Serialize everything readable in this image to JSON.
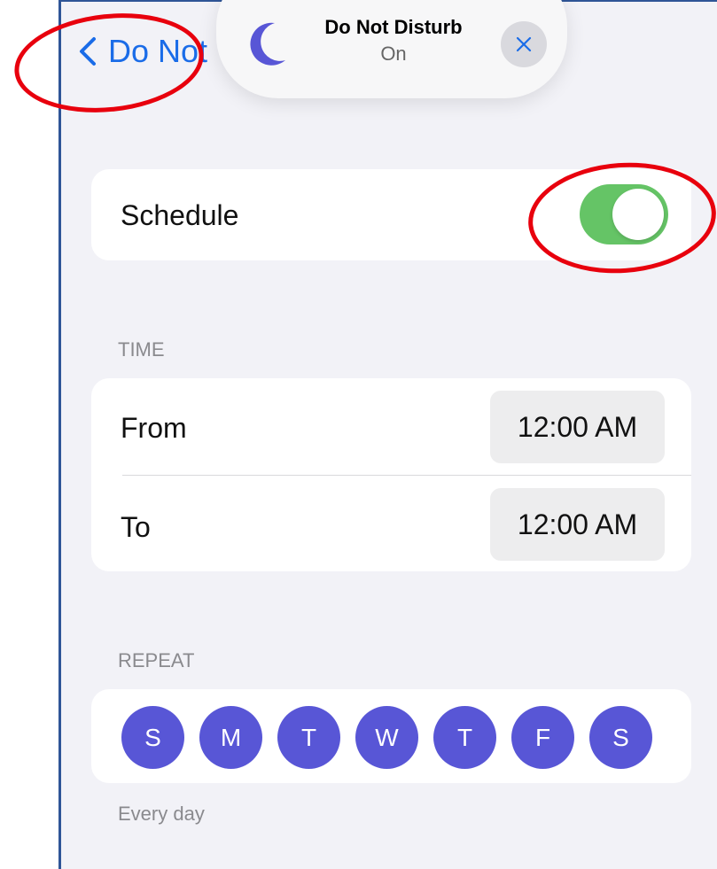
{
  "nav": {
    "back_label": "Do Not",
    "back_icon": "chevron-left-icon"
  },
  "banner": {
    "title": "Do Not Disturb",
    "status": "On",
    "icon": "moon-icon",
    "close_icon": "close-icon"
  },
  "schedule": {
    "label": "Schedule",
    "enabled": true
  },
  "time": {
    "header": "TIME",
    "from_label": "From",
    "from_value": "12:00 AM",
    "to_label": "To",
    "to_value": "12:00 AM"
  },
  "repeat": {
    "header": "REPEAT",
    "days": [
      "S",
      "M",
      "T",
      "W",
      "T",
      "F",
      "S"
    ],
    "summary": "Every day"
  },
  "colors": {
    "accent": "#1a6ce8",
    "toggle_on": "#65c466",
    "day_selected": "#5856d6",
    "annotation": "#e8000d"
  }
}
